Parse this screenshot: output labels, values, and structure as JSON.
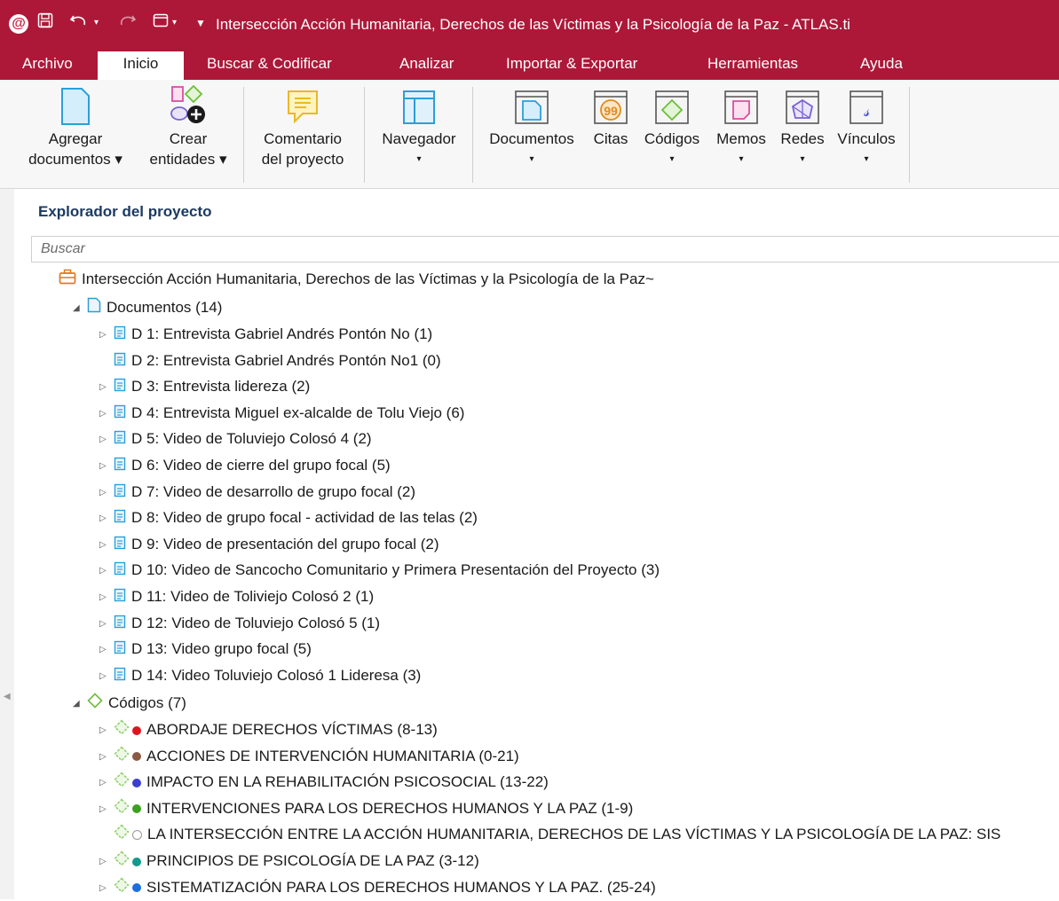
{
  "window": {
    "title": "Intersección Acción Humanitaria, Derechos de las Víctimas y la Psicología de la Paz - ATLAS.ti",
    "logo_letter": "@",
    "save_icon": "save-icon",
    "undo_icon": "undo-icon",
    "redo_icon": "redo-icon",
    "window_icon": "window-icon"
  },
  "menu": {
    "items": [
      "Archivo",
      "Inicio",
      "Buscar & Codificar",
      "Analizar",
      "Importar & Exportar",
      "Herramientas",
      "Ayuda"
    ],
    "active": "Inicio"
  },
  "ribbon": {
    "add_documents": [
      "Agregar",
      "documentos ▾"
    ],
    "create_entities": [
      "Crear",
      "entidades ▾"
    ],
    "project_comment": [
      "Comentario",
      "del proyecto"
    ],
    "navigator": [
      "Navegador",
      "▾"
    ],
    "documents": [
      "Documentos",
      "▾"
    ],
    "quotes": [
      "Citas",
      ""
    ],
    "codes": [
      "Códigos",
      "▾"
    ],
    "memos": [
      "Memos",
      "▾"
    ],
    "networks": [
      "Redes",
      "▾"
    ],
    "links": [
      "Vínculos",
      "▾"
    ]
  },
  "explorer": {
    "title": "Explorador del proyecto",
    "search_placeholder": "Buscar",
    "project_name": "Intersección Acción Humanitaria, Derechos de las Víctimas y la Psicología de la Paz~",
    "documents_group": "Documentos (14)",
    "documents": [
      {
        "label": "D 1: Entrevista Gabriel Andrés Pontón No (1)",
        "expandable": true
      },
      {
        "label": "D 2: Entrevista Gabriel Andrés Pontón No1 (0)",
        "expandable": false
      },
      {
        "label": "D 3: Entrevista lidereza (2)",
        "expandable": true
      },
      {
        "label": "D 4: Entrevista Miguel ex-alcalde de Tolu Viejo (6)",
        "expandable": true
      },
      {
        "label": "D 5: Video de  Toluviejo Colosó 4 (2)",
        "expandable": true
      },
      {
        "label": "D 6: Video de cierre del grupo focal (5)",
        "expandable": true
      },
      {
        "label": "D 7: Video de desarrollo de grupo focal (2)",
        "expandable": true
      },
      {
        "label": "D 8: Video de grupo focal - actividad de las telas (2)",
        "expandable": true
      },
      {
        "label": "D 9: Video de presentación del grupo focal (2)",
        "expandable": true
      },
      {
        "label": "D 10: Video de Sancocho Comunitario y Primera Presentación del Proyecto (3)",
        "expandable": true
      },
      {
        "label": "D 11: Video de Toliviejo Colosó 2 (1)",
        "expandable": true
      },
      {
        "label": "D 12: Video de Toluviejo Colosó 5 (1)",
        "expandable": true
      },
      {
        "label": "D 13: Video grupo focal (5)",
        "expandable": true
      },
      {
        "label": "D 14: Video Toluviejo Colosó 1 Lideresa (3)",
        "expandable": true
      }
    ],
    "codes_group": "Códigos (7)",
    "codes": [
      {
        "label": "ABORDAJE DERECHOS VÍCTIMAS (8-13)",
        "color": "#e0141e",
        "expandable": true
      },
      {
        "label": "ACCIONES DE INTERVENCIÓN HUMANITARIA (0-21)",
        "color": "#8a5a44",
        "expandable": true
      },
      {
        "label": "IMPACTO EN LA REHABILITACIÓN PSICOSOCIAL (13-22)",
        "color": "#3b3fd0",
        "expandable": true
      },
      {
        "label": "INTERVENCIONES PARA LOS DERECHOS HUMANOS Y LA PAZ (1-9)",
        "color": "#3aa21e",
        "expandable": true
      },
      {
        "label": "LA INTERSECCIÓN ENTRE LA ACCIÓN HUMANITARIA, DERECHOS DE LAS VÍCTIMAS Y LA PSICOLOGÍA DE LA PAZ: SIS",
        "color": "#ffffff",
        "expandable": false
      },
      {
        "label": "PRINCIPIOS DE PSICOLOGÍA DE LA PAZ (3-12)",
        "color": "#129a8c",
        "expandable": true
      },
      {
        "label": "SISTEMATIZACIÓN PARA LOS DERECHOS HUMANOS Y LA PAZ. (25-24)",
        "color": "#1a6fe0",
        "expandable": true
      }
    ]
  },
  "colors": {
    "brand": "#ad1838",
    "ribbon_bg": "#f7f7f7",
    "doc_icon": "#2b9fd8",
    "code_icon": "#6cbf3a",
    "panel_title": "#1b3a63"
  }
}
